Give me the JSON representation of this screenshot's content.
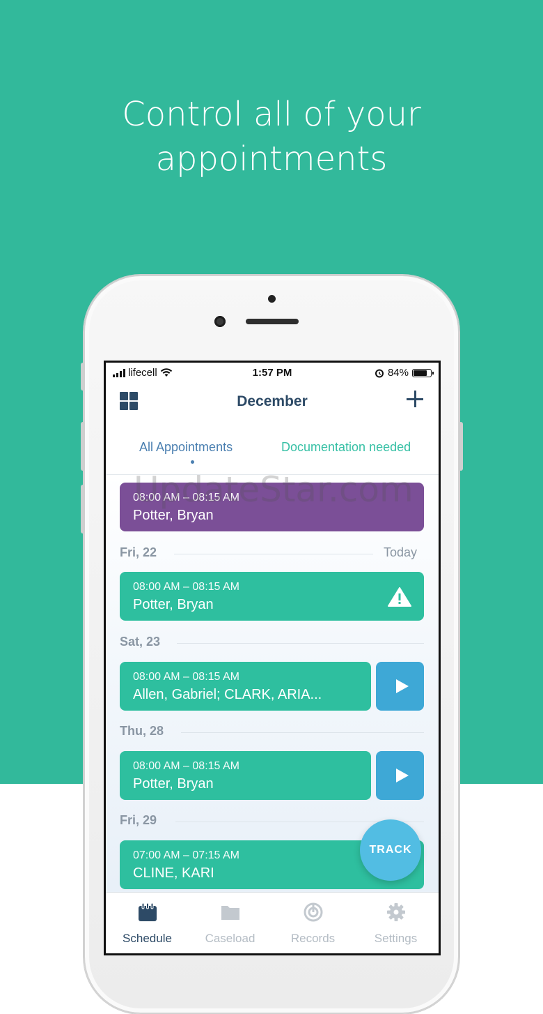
{
  "headline": {
    "line1": "Control all of your",
    "line2": "appointments"
  },
  "status_bar": {
    "carrier": "lifecell",
    "time": "1:57 PM",
    "battery": "84%",
    "battery_level": 0.84
  },
  "nav": {
    "title": "December"
  },
  "tabs": {
    "all": "All Appointments",
    "documentation": "Documentation needed"
  },
  "watermark": "UpdateStar.com",
  "appointments_top": {
    "time": "08:00 AM – 08:15 AM",
    "name": "Potter, Bryan"
  },
  "days": [
    {
      "label": "Fri, 22",
      "extra": "Today",
      "appointments": [
        {
          "time": "08:00 AM – 08:15 AM",
          "name": "Potter, Bryan"
        }
      ]
    },
    {
      "label": "Sat, 23",
      "appointments": [
        {
          "time": "08:00 AM – 08:15 AM",
          "name": "Allen, Gabriel; CLARK, ARIA..."
        }
      ]
    },
    {
      "label": "Thu, 28",
      "appointments": [
        {
          "time": "08:00 AM – 08:15 AM",
          "name": "Potter, Bryan"
        }
      ]
    },
    {
      "label": "Fri, 29",
      "appointments": [
        {
          "time": "07:00 AM – 07:15 AM",
          "name": "CLINE, KARI"
        }
      ]
    }
  ],
  "track_button": "TRACK",
  "tabbar": {
    "schedule": "Schedule",
    "caseload": "Caseload",
    "records": "Records",
    "settings": "Settings"
  },
  "colors": {
    "brand_green": "#32b99b",
    "card_green": "#2ebf9f",
    "card_purple": "#7b4f97",
    "play_blue": "#3ea8d6",
    "navy": "#2d4a66"
  }
}
